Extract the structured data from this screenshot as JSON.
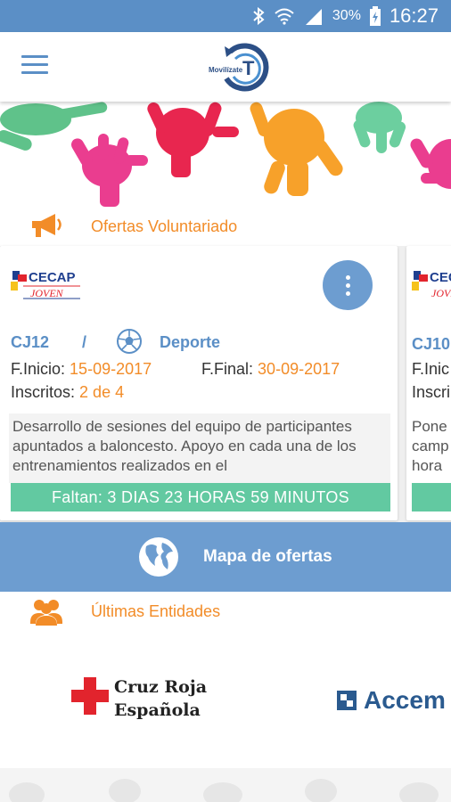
{
  "status_bar": {
    "battery": "30%",
    "time": "16:27"
  },
  "header": {
    "logo_text": "Movilízate",
    "logo_letter": "T"
  },
  "offers_section": {
    "label": "Ofertas Voluntariado"
  },
  "offer_card": {
    "org_logo_text": "CECAP",
    "org_logo_sub": "JOVEN",
    "code": "CJ12",
    "separator": "/",
    "category": "Deporte",
    "start_label": "F.Inicio:",
    "start_date": "15-09-2017",
    "end_label": "F.Final:",
    "end_date": "30-09-2017",
    "enrolled_label": "Inscritos:",
    "enrolled_value": "2 de 4",
    "description": "Desarrollo de sesiones del equipo de participantes apuntados a baloncesto. Apoyo en cada una de los entrenamientos realizados en el",
    "countdown": "Faltan: 3 DIAS 23 HORAS 59 MINUTOS"
  },
  "offer_card_2": {
    "org_logo_text": "CECAP",
    "org_logo_sub": "JOVEN",
    "code": "CJ10",
    "start_label": "F.Inic",
    "enrolled_label": "Inscri",
    "description_lines": [
      "Pone",
      "camp",
      "hora"
    ]
  },
  "map_button": {
    "label": "Mapa de ofertas"
  },
  "entities_section": {
    "label": "Últimas Entidades"
  },
  "entities": [
    {
      "name_line1": "Cruz Roja",
      "name_line2": "Española"
    },
    {
      "name": "Accem"
    }
  ],
  "colors": {
    "primary": "#5b8fc6",
    "accent": "#f28c28",
    "countdown": "#62c9a1",
    "map_bar": "#6d9dd0"
  },
  "icons": [
    "bluetooth-icon",
    "wifi-icon",
    "signal-icon",
    "battery-icon",
    "menu-icon",
    "megaphone-icon",
    "more-vert-icon",
    "soccer-ball-icon",
    "globe-icon",
    "people-icon",
    "red-cross-icon"
  ]
}
